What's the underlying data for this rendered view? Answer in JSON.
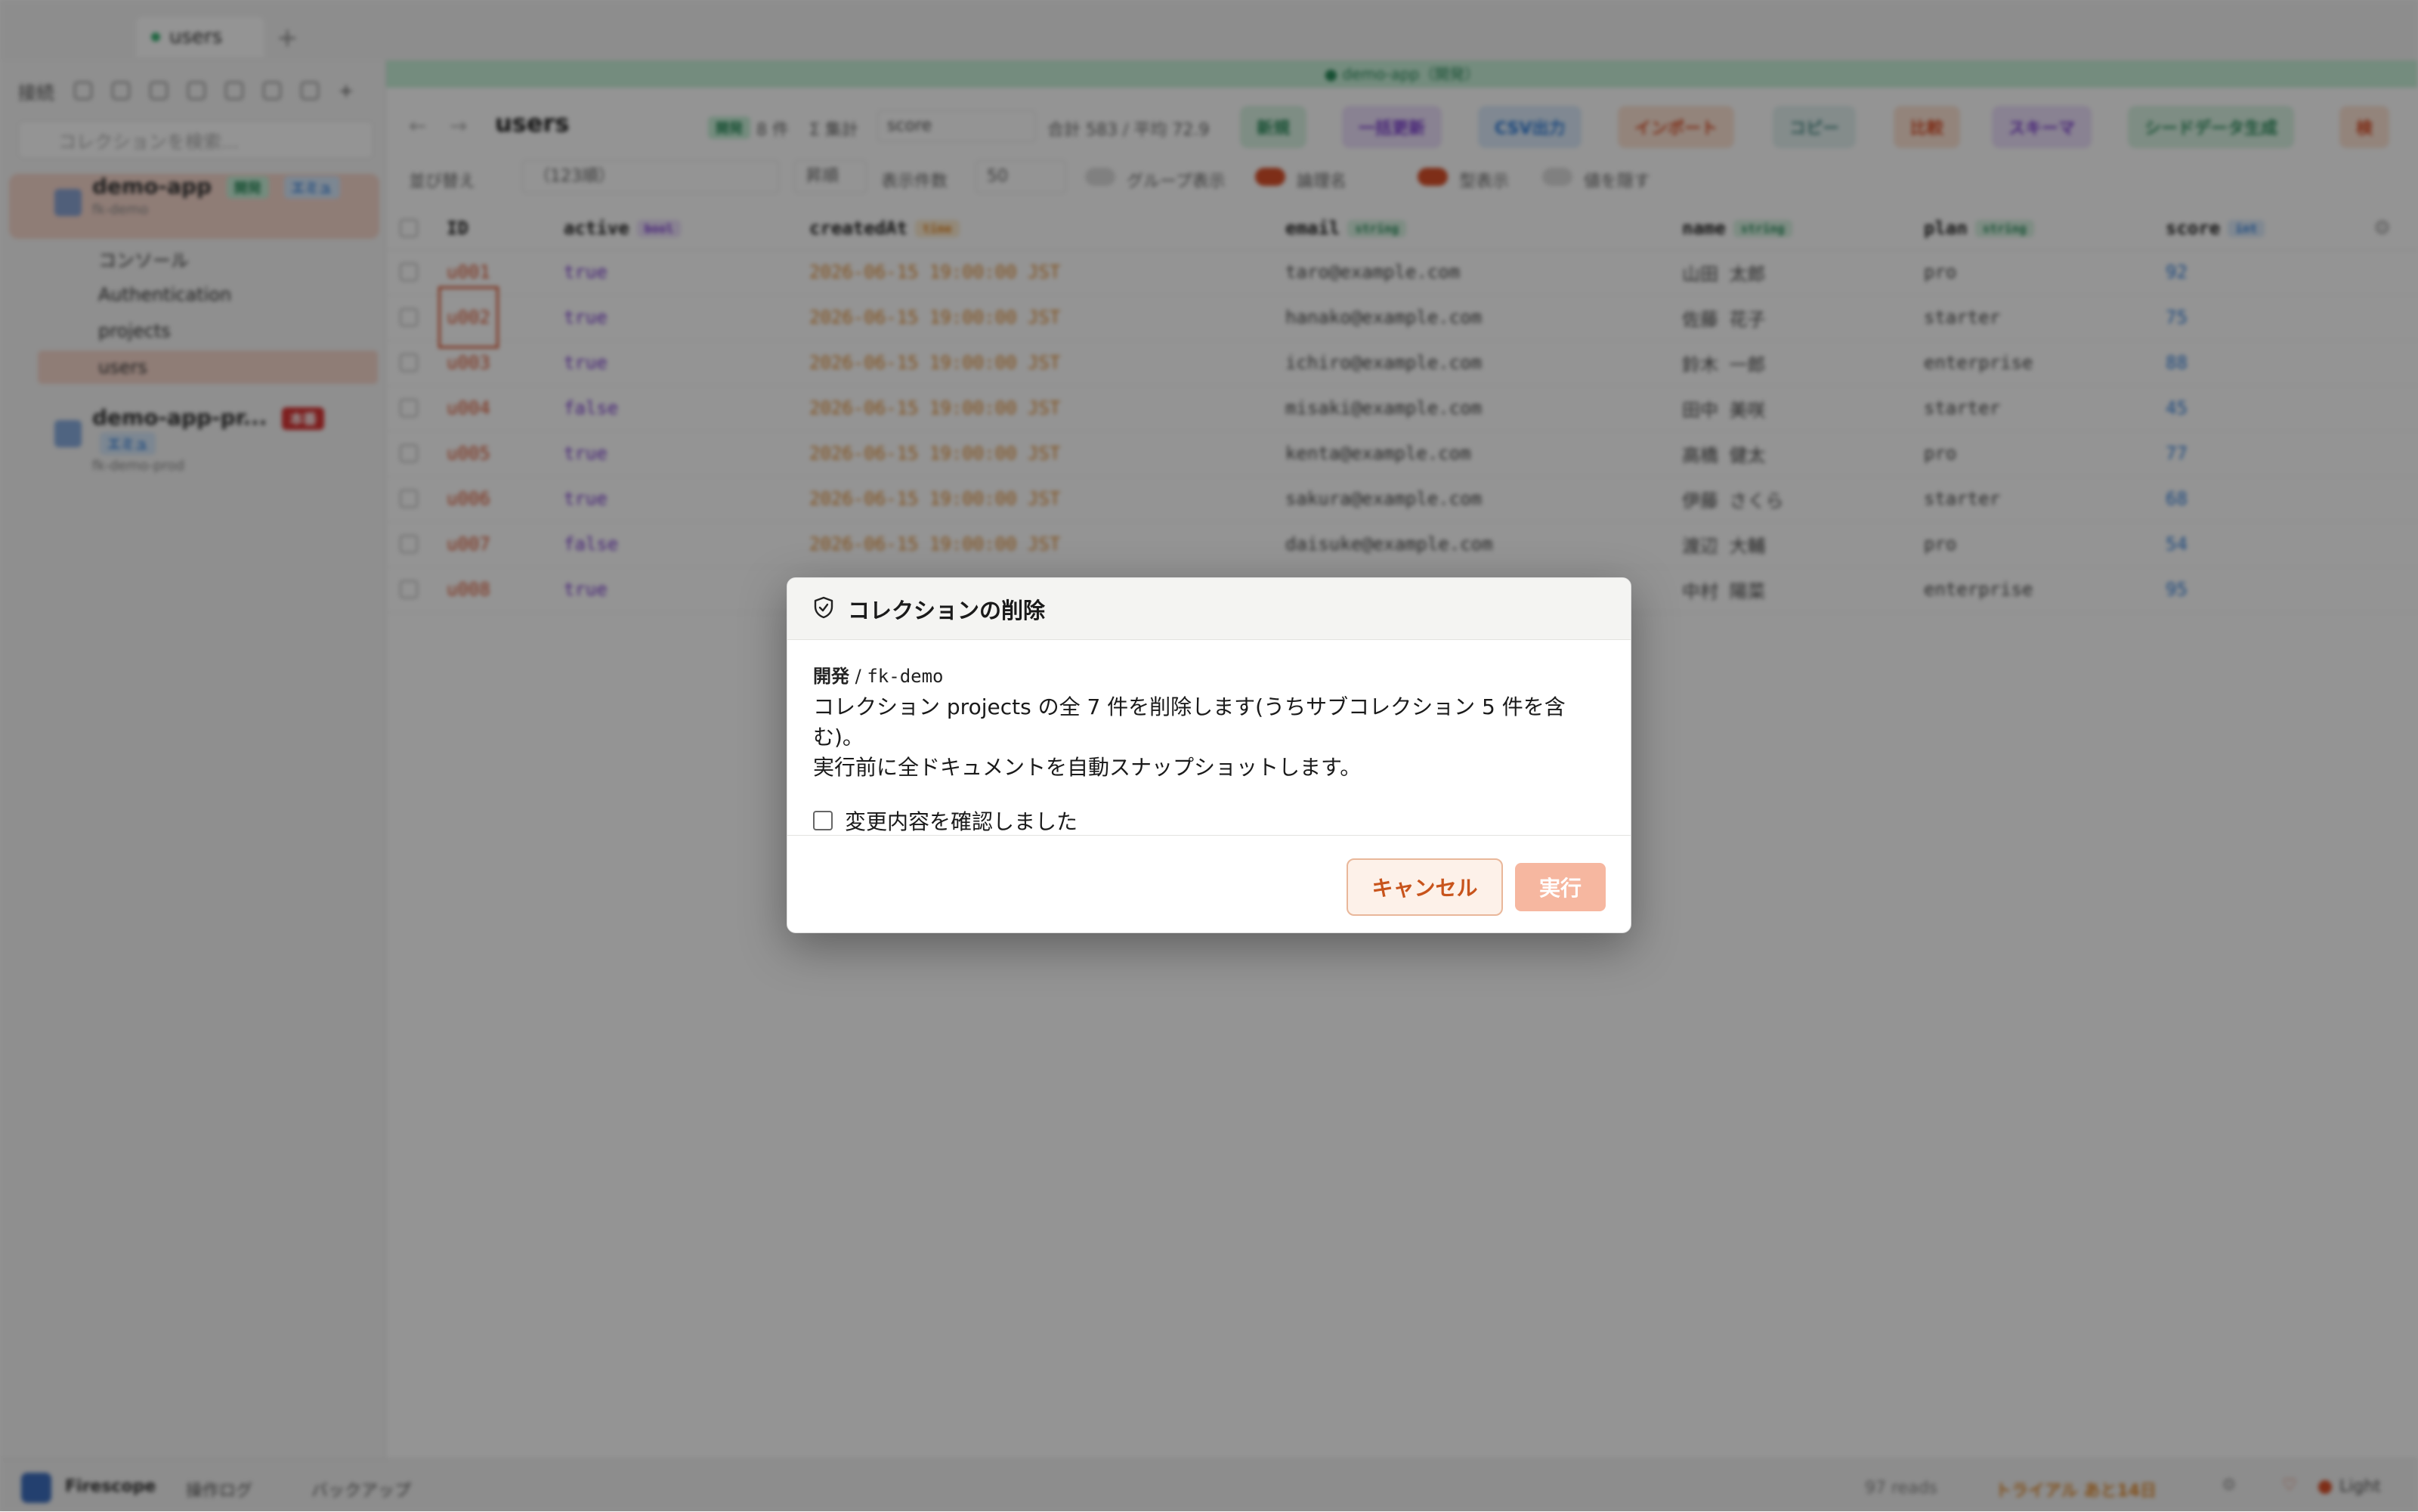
{
  "tabbar": {
    "tab_label": "users",
    "add_label": "+"
  },
  "sidebar": {
    "head_label": "接続",
    "search_placeholder": "コレクションを検索...",
    "projects": [
      {
        "name": "demo-app",
        "sub": "fk-demo",
        "badge_env": "開発",
        "badge_type": "エミュ"
      },
      {
        "name": "demo-app-pr...",
        "sub": "fk-demo-prod",
        "badge_env": "本番",
        "badge_type": "エミュ"
      }
    ],
    "tree": [
      {
        "label": "コンソール",
        "icon": "console-icon"
      },
      {
        "label": "Authentication",
        "icon": "user-icon"
      },
      {
        "label": "projects",
        "icon": "folder-icon"
      },
      {
        "label": "users",
        "icon": "collection-icon"
      }
    ]
  },
  "main": {
    "banner": "● demo-app（開発）",
    "title": "users",
    "env_badge": "開発",
    "count_label": "8 件",
    "aggregate_label": "Σ 集計",
    "aggregate_field": "score",
    "aggregate_result": "合計 583 / 平均 72.9",
    "buttons": [
      "新規",
      "一括更新",
      "CSV出力",
      "インポート",
      "コピー",
      "比較",
      "スキーマ",
      "シードデータ生成",
      "検"
    ],
    "filters": {
      "sort_label": "並び替え",
      "sort_value": "（123順）",
      "order_value": "昇順",
      "page_size_label": "表示件数",
      "page_size_value": "50",
      "group_label": "グループ表示",
      "logical_label": "論理名",
      "type_label": "型表示",
      "wrap_label": "値を隠す"
    },
    "columns": [
      {
        "name": "ID",
        "type": ""
      },
      {
        "name": "active",
        "type": "bool"
      },
      {
        "name": "createdAt",
        "type": "time"
      },
      {
        "name": "email",
        "type": "string"
      },
      {
        "name": "name",
        "type": "string"
      },
      {
        "name": "plan",
        "type": "string"
      },
      {
        "name": "score",
        "type": "int"
      }
    ],
    "rows": [
      {
        "id": "u001",
        "active": "true",
        "createdAt": "2026-06-15 19:00:00 JST",
        "email": "taro@example.com",
        "name": "山田 太郎",
        "plan": "pro",
        "score": "92"
      },
      {
        "id": "u002",
        "active": "true",
        "createdAt": "2026-06-15 19:00:00 JST",
        "email": "hanako@example.com",
        "name": "佐藤 花子",
        "plan": "starter",
        "score": "75"
      },
      {
        "id": "u003",
        "active": "true",
        "createdAt": "2026-06-15 19:00:00 JST",
        "email": "ichiro@example.com",
        "name": "鈴木 一郎",
        "plan": "enterprise",
        "score": "88"
      },
      {
        "id": "u004",
        "active": "false",
        "createdAt": "2026-06-15 19:00:00 JST",
        "email": "misaki@example.com",
        "name": "田中 美咲",
        "plan": "starter",
        "score": "45"
      },
      {
        "id": "u005",
        "active": "true",
        "createdAt": "2026-06-15 19:00:00 JST",
        "email": "kenta@example.com",
        "name": "高橋 健太",
        "plan": "pro",
        "score": "77"
      },
      {
        "id": "u006",
        "active": "true",
        "createdAt": "2026-06-15 19:00:00 JST",
        "email": "sakura@example.com",
        "name": "伊藤 さくら",
        "plan": "starter",
        "score": "68"
      },
      {
        "id": "u007",
        "active": "false",
        "createdAt": "2026-06-15 19:00:00 JST",
        "email": "daisuke@example.com",
        "name": "渡辺 大輔",
        "plan": "pro",
        "score": "54"
      },
      {
        "id": "u008",
        "active": "true",
        "createdAt": "",
        "email": "",
        "name": "中村 陽菜",
        "plan": "enterprise",
        "score": "95"
      }
    ]
  },
  "statusbar": {
    "app_name": "Firescope",
    "log_label": "操作ログ",
    "backup_label": "バックアップ",
    "reads": "97 reads",
    "trial": "トライアル あと14日",
    "theme": "Light"
  },
  "dialog": {
    "title": "コレクションの削除",
    "env_name": "開発",
    "env_sep": " / ",
    "project_id": "fk-demo",
    "message_line1": "コレクション projects の全 7 件を削除します(うちサブコレクション 5 件を含む)。",
    "message_line2": "実行前に全ドキュメントを自動スナップショットします。",
    "confirm_label": "変更内容を確認しました",
    "cancel_label": "キャンセル",
    "execute_label": "実行"
  },
  "colors": {
    "accent": "#c8541c",
    "execute_disabled": "#f6b7a0",
    "id_text": "#d9502a",
    "bool_text": "#7a3ccf",
    "time_text": "#e0892c",
    "int_text": "#2d7bd8"
  }
}
